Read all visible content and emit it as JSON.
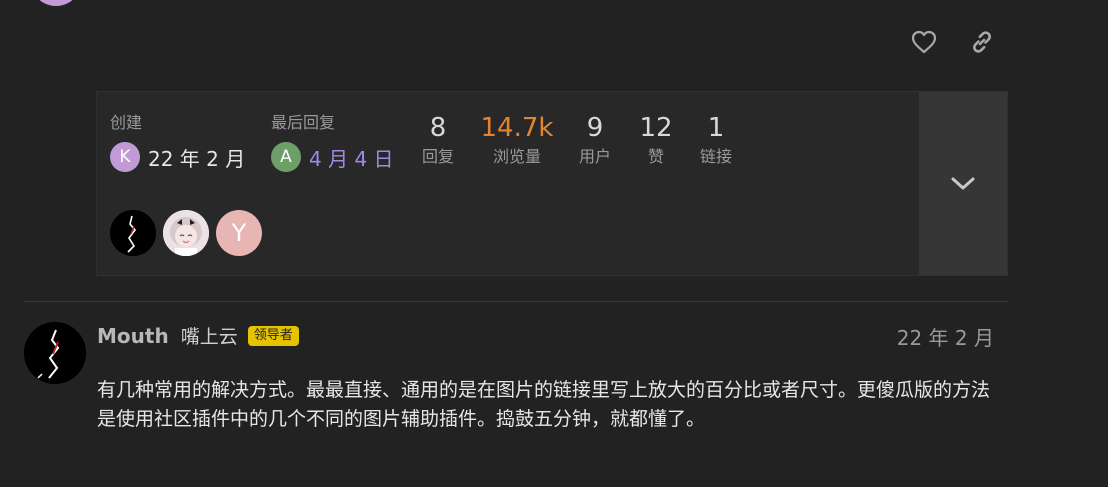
{
  "actions": {
    "like_icon": "heart-icon",
    "link_icon": "link-icon"
  },
  "topic_map": {
    "created": {
      "label": "创建",
      "avatar_letter": "K",
      "date": "22 年 2 月",
      "avatar_color": "#c29bd6"
    },
    "last_reply": {
      "label": "最后回复",
      "avatar_letter": "A",
      "date": "4 月 4 日",
      "avatar_color": "#6e9f68"
    },
    "stats": [
      {
        "number": "8",
        "label": "回复"
      },
      {
        "number": "14.7k",
        "label": "浏览量"
      },
      {
        "number": "9",
        "label": "用户"
      },
      {
        "number": "12",
        "label": "赞"
      },
      {
        "number": "1",
        "label": "链接"
      }
    ],
    "participants": [
      {
        "type": "image",
        "icon": "dark-avatar"
      },
      {
        "type": "image",
        "icon": "anime-avatar"
      },
      {
        "type": "letter",
        "letter": "Y"
      }
    ],
    "expand_icon": "chevron-down-icon"
  },
  "post": {
    "username": "Mouth",
    "full_name": "嘴上云",
    "flair": "领导者",
    "date": "22 年 2 月",
    "body": "有几种常用的解决方式。最最直接、通用的是在图片的链接里写上放大的百分比或者尺寸。更傻瓜版的方法是使用社区插件中的几个不同的图片辅助插件。捣鼓五分钟，就都懂了。"
  },
  "colors": {
    "background": "#222222",
    "accent_views": "#e6842e",
    "link_date": "#a386e6",
    "flair": "#e6c300"
  }
}
